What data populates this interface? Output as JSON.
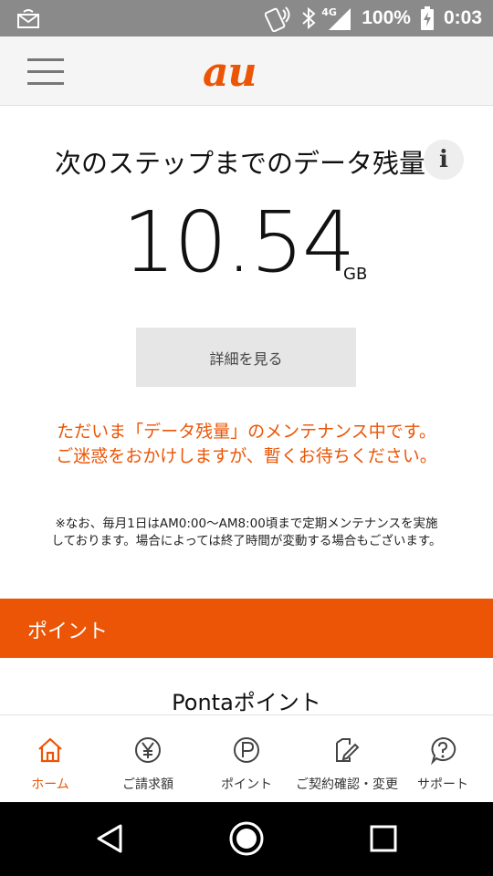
{
  "status_bar": {
    "network": "4G",
    "battery": "100%",
    "time": "0:03",
    "icons": [
      "notification-icon",
      "nfc-icon",
      "bluetooth-icon",
      "signal-icon",
      "battery-icon"
    ]
  },
  "app_bar": {
    "menu_icon": "hamburger-icon",
    "logo": "au",
    "brand_color": "#eb5505"
  },
  "data_remaining": {
    "title": "次のステップまでのデータ残量",
    "info_icon": "i",
    "value": "10.54",
    "unit": "GB",
    "details_button": "詳細を見る"
  },
  "maintenance": {
    "message_line1": "ただいま「データ残量」のメンテナンス中です。",
    "message_line2": "ご迷惑をおかけしますが、暫くお待ちください。",
    "note": "※なお、毎月1日はAM0:00〜AM8:00頃まで定期メンテナンスを実施しております。場合によっては終了時間が変動する場合もございます。"
  },
  "points": {
    "section_title": "ポイント",
    "ponta_label": "Pontaポイント"
  },
  "bottom_nav": {
    "items": [
      {
        "label": "ホーム",
        "icon": "home-icon",
        "active": true
      },
      {
        "label": "ご請求額",
        "icon": "yen-icon",
        "active": false
      },
      {
        "label": "ポイント",
        "icon": "point-icon",
        "active": false
      },
      {
        "label": "ご契約確認・変更",
        "icon": "contract-edit-icon",
        "active": false
      },
      {
        "label": "サポート",
        "icon": "help-icon",
        "active": false
      }
    ]
  },
  "system_nav": {
    "icons": [
      "back-icon",
      "home-circle-icon",
      "recents-icon"
    ]
  }
}
